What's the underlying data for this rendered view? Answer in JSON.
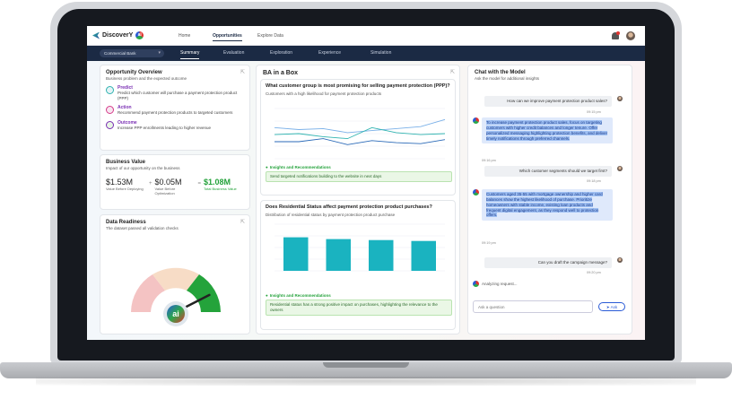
{
  "app": {
    "brand_text": "DiscoverY",
    "brand_badge": "ai"
  },
  "topnav": {
    "links": [
      "Home",
      "Opportunities",
      "Explore Data"
    ]
  },
  "subnav": {
    "selector_value": "Commercial Bank",
    "tabs": [
      "Summary",
      "Evaluation",
      "Exploration",
      "Experience",
      "Simulation"
    ]
  },
  "opportunity": {
    "title": "Opportunity Overview",
    "subtitle": "Business problem and the expected outcome",
    "items": [
      {
        "head": "Predict",
        "text": "Predict which customer will purchase a payment protection product (PPP)"
      },
      {
        "head": "Action",
        "text": "Recommend payment protection products to targeted customers"
      },
      {
        "head": "Outcome",
        "text": "Increase PPP enrollments leading to higher revenue"
      }
    ]
  },
  "business_value": {
    "title": "Business Value",
    "subtitle": "Impact of our opportunity on the business",
    "items": [
      {
        "value": "$1.53M",
        "label": "Value Before Deploying"
      },
      {
        "value": "$0.05M",
        "label": "Value Before Optimization"
      },
      {
        "value": "$1.08M",
        "label": "Total Business Value"
      }
    ],
    "ops": [
      "+",
      "="
    ]
  },
  "data_readiness": {
    "title": "Data Readiness",
    "subtitle": "The dataset passed all validation checks",
    "gauge_level": 0.85,
    "gauge_badge": "ai"
  },
  "ba_box": {
    "title": "BA in a Box",
    "q1": {
      "question": "What customer group is most promising for selling payment protection (PPP)?",
      "desc": "Customers with a high likelihood for payment protection products",
      "rec_head": "Insights and Recommendations",
      "rec_text": "Send targeted notifications building to the website in next days"
    },
    "q2": {
      "question": "Does Residential Status affect payment protection product purchases?",
      "desc": "Distribution of residential status by payment protection product purchase",
      "rec_head": "Insights and Recommendations",
      "rec_text": "Residential status has a strong positive impact on purchases, highlighting the relevance to the owners"
    }
  },
  "chart_data": [
    {
      "type": "line",
      "x": [
        1,
        2,
        3,
        4,
        5,
        6,
        7,
        8
      ],
      "series": [
        {
          "values": [
            0.62,
            0.58,
            0.6,
            0.52,
            0.56,
            0.6,
            0.64,
            0.78
          ]
        },
        {
          "values": [
            0.48,
            0.5,
            0.44,
            0.4,
            0.62,
            0.52,
            0.48,
            0.5
          ]
        },
        {
          "values": [
            0.34,
            0.34,
            0.4,
            0.28,
            0.36,
            0.32,
            0.3,
            0.38
          ]
        }
      ],
      "colors": [
        "#7ab0e8",
        "#2fb3b0",
        "#2b6ab8"
      ],
      "grid": true
    },
    {
      "type": "bar",
      "categories": [
        "A",
        "B",
        "C",
        "D"
      ],
      "values": [
        0.72,
        0.68,
        0.66,
        0.64
      ],
      "colors": [
        "#1ab3c0"
      ],
      "grid": true
    }
  ],
  "chat": {
    "title": "Chat with the Model",
    "subtitle": "Ask the model for additional insights",
    "messages": [
      {
        "role": "user",
        "text": "How can we improve payment protection product sales?",
        "time": "09:15 pm"
      },
      {
        "role": "bot",
        "text": "To increase payment protection product sales, focus on targeting customers with higher credit balances and longer tenure. Offer personalized messaging highlighting protection benefits, and deliver timely notifications through preferred channels.",
        "time": "09:16 pm"
      },
      {
        "role": "user",
        "text": "Which customer segments should we target first?",
        "time": "09:18 pm"
      },
      {
        "role": "bot",
        "text": "Customers aged 35-55 with mortgage ownership and higher card balances show the highest likelihood of purchase. Prioritize homeowners with stable income, existing loan products and frequent digital engagement, as they respond well to protection offers.",
        "time": "09:19 pm"
      },
      {
        "role": "user",
        "text": "Can you draft the campaign message?",
        "time": "09:20 pm"
      }
    ],
    "typing_text": "Analyzing request...",
    "input_placeholder": "Ask a question",
    "ask_label": "Ask"
  },
  "icons": {
    "expand": "expand-icon",
    "bulb": "lightbulb-icon",
    "bell": "bell-icon",
    "send": "send-icon"
  },
  "colors": {
    "navy": "#1b2a44",
    "green": "#23a23a",
    "purple": "#7a2fb3",
    "chat_blue": "#2a5bd6"
  }
}
